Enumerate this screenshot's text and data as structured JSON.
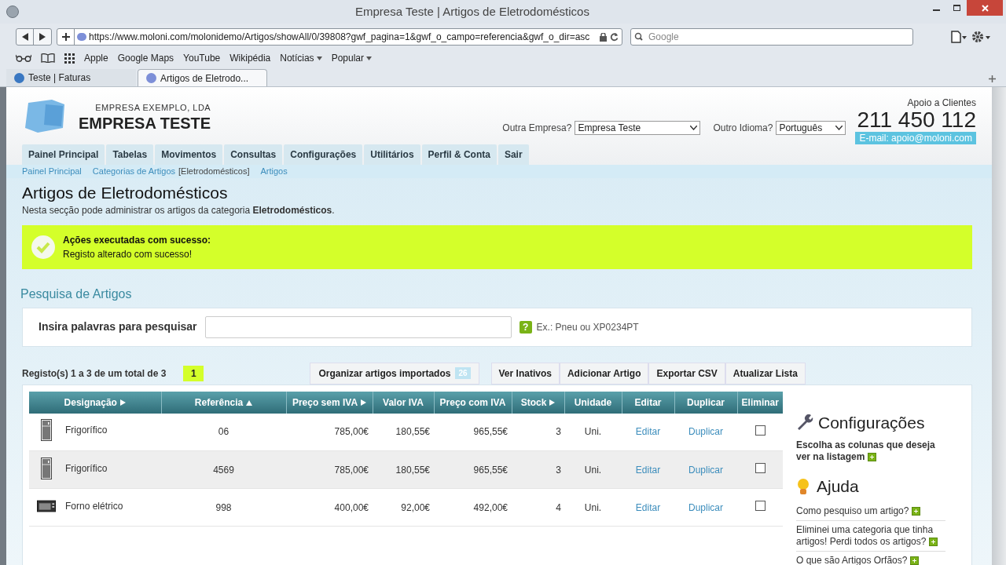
{
  "window": {
    "title": "Empresa Teste | Artigos de Eletrodomésticos"
  },
  "browser": {
    "url": "https://www.moloni.com/molonidemo/Artigos/showAll/0/39808?gwf_pagina=1&gwf_o_campo=referencia&gwf_o_dir=asc",
    "search_placeholder": "Google",
    "bookmarks": [
      {
        "label": "Apple",
        "menu": false
      },
      {
        "label": "Google Maps",
        "menu": false
      },
      {
        "label": "YouTube",
        "menu": false
      },
      {
        "label": "Wikipédia",
        "menu": false
      },
      {
        "label": "Notícias",
        "menu": true
      },
      {
        "label": "Popular",
        "menu": true
      }
    ],
    "tabs": [
      {
        "label": "Teste | Faturas",
        "selected": false
      },
      {
        "label": "Artigos de Eletrodo...",
        "selected": true
      }
    ]
  },
  "header": {
    "company_sub": "EMPRESA EXEMPLO, LDA",
    "company_name": "EMPRESA TESTE",
    "support_label": "Apoio a Clientes",
    "phone": "211 450 112",
    "email": "E-mail: apoio@moloni.com",
    "company_select": {
      "label": "Outra Empresa?",
      "value": "Empresa Teste"
    },
    "language_select": {
      "label": "Outro Idioma?",
      "value": "Português"
    }
  },
  "nav": [
    "Painel Principal",
    "Tabelas",
    "Movimentos",
    "Consultas",
    "Configurações",
    "Utilitários",
    "Perfil & Conta",
    "Sair"
  ],
  "breadcrumb": [
    {
      "label": "Painel Principal",
      "kind": "link"
    },
    {
      "label": "Categorias de Artigos",
      "kind": "link"
    },
    {
      "label": "[Eletrodomésticos]",
      "kind": "text"
    },
    {
      "label": "Artigos",
      "kind": "link"
    }
  ],
  "page": {
    "title": "Artigos de Eletrodomésticos",
    "description": "Nesta secção pode administrar os artigos da categoria **Eletrodomésticos**."
  },
  "alert": {
    "title": "Ações executadas com sucesso:",
    "message": "Registo alterado com sucesso!"
  },
  "search": {
    "title": "Pesquisa de Artigos",
    "label": "Insira palavras para pesquisar",
    "hint": "Ex.: Pneu ou XP0234PT",
    "help_icon": "?"
  },
  "records": {
    "summary": "Registo(s) 1 a 3 de um total de 3",
    "pages": [
      {
        "label": "1",
        "selected": true
      }
    ]
  },
  "import_button": {
    "label": "Organizar artigos importados",
    "count": "26"
  },
  "actions": [
    "Ver Inativos",
    "Adicionar Artigo",
    "Exportar CSV",
    "Atualizar Lista"
  ],
  "table": {
    "columns": [
      {
        "label": "Designação",
        "kind": "sortable"
      },
      {
        "label": "Referência",
        "kind": "sorted"
      },
      {
        "label": "Preço sem IVA",
        "kind": "sortable"
      },
      {
        "label": "Valor IVA",
        "kind": "plain"
      },
      {
        "label": "Preço com IVA",
        "kind": "plain"
      },
      {
        "label": "Stock",
        "kind": "sortable"
      },
      {
        "label": "Unidade",
        "kind": "plain"
      },
      {
        "label": "Editar",
        "kind": "plain"
      },
      {
        "label": "Duplicar",
        "kind": "plain"
      },
      {
        "label": "Eliminar",
        "kind": "plain"
      }
    ],
    "rows": [
      {
        "kind": "fridge",
        "designation": "Frigorífico",
        "reference": "06",
        "price": "785,00€",
        "vat": "180,55€",
        "total": "965,55€",
        "stock": "3",
        "unit": "Uni.",
        "edit": "Editar",
        "duplicate": "Duplicar",
        "checked": false,
        "highlighted": false
      },
      {
        "kind": "fridge",
        "designation": "Frigorífico",
        "reference": "4569",
        "price": "785,00€",
        "vat": "180,55€",
        "total": "965,55€",
        "stock": "3",
        "unit": "Uni.",
        "edit": "Editar",
        "duplicate": "Duplicar",
        "checked": false,
        "highlighted": true
      },
      {
        "kind": "oven",
        "designation": "Forno elétrico",
        "reference": "998",
        "price": "400,00€",
        "vat": "92,00€",
        "total": "492,00€",
        "stock": "4",
        "unit": "Uni.",
        "edit": "Editar",
        "duplicate": "Duplicar",
        "checked": false,
        "highlighted": false
      }
    ]
  },
  "sidebar": {
    "config_title": "Configurações",
    "config_text": "Escolha as colunas que deseja ver na listagem",
    "help_title": "Ajuda",
    "help_items": [
      "Como pesquiso um artigo?",
      "Eliminei uma categoria que tinha artigos! Perdi todos os artigos?",
      "O que são Artigos Orfãos?"
    ]
  }
}
